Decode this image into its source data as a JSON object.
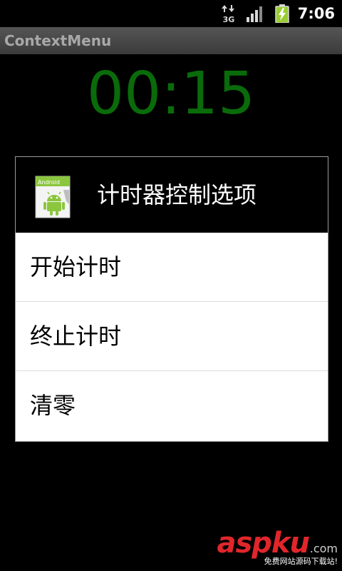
{
  "status_bar": {
    "network_label": "3G",
    "time": "7:06",
    "icons": [
      "data-transfer-icon",
      "signal-strength-icon",
      "battery-charging-icon"
    ]
  },
  "app": {
    "title": "ContextMenu"
  },
  "timer": {
    "display": "00:15",
    "color": "#0a6b0a"
  },
  "context_menu": {
    "title": "计时器控制选项",
    "icon": "android-app-icon",
    "icon_label": "Android",
    "items": [
      {
        "label": "开始计时"
      },
      {
        "label": "终止计时"
      },
      {
        "label": "清零"
      }
    ]
  },
  "watermark": {
    "brand": "aspku",
    "domain": ".com",
    "tagline": "免费网站源码下载站!",
    "color": "#e1262b"
  }
}
